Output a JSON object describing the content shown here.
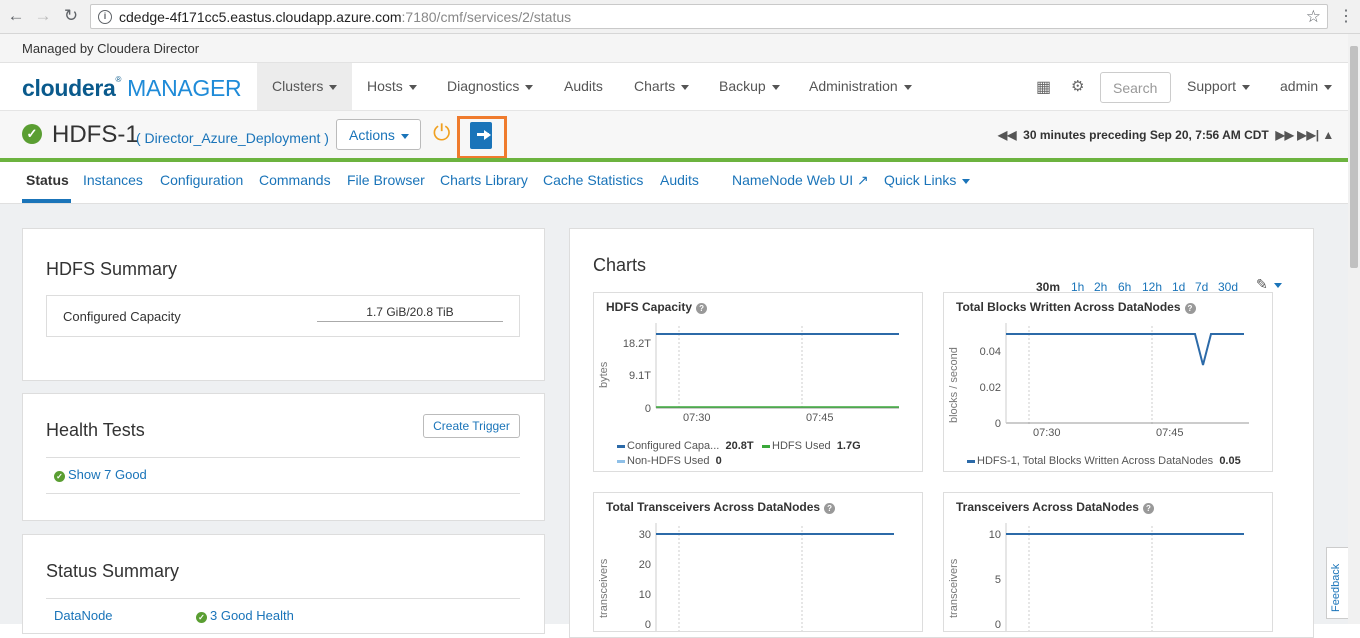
{
  "browser": {
    "url_host": "cdedge-4f171cc5.eastus.cloudapp.azure.com",
    "url_rest": ":7180/cmf/services/2/status"
  },
  "managed_by": "Managed by Cloudera Director",
  "topnav": {
    "logo_cloudera": "cloudera",
    "logo_manager": "MANAGER",
    "items": [
      "Clusters",
      "Hosts",
      "Diagnostics",
      "Audits",
      "Charts",
      "Backup",
      "Administration"
    ],
    "search_placeholder": "Search",
    "support": "Support",
    "user": "admin"
  },
  "service": {
    "name": "HDFS-1",
    "deployment": "( Director_Azure_Deployment )",
    "actions": "Actions",
    "timerange": "30 minutes preceding Sep 20, 7:56 AM CDT"
  },
  "subnav": [
    "Status",
    "Instances",
    "Configuration",
    "Commands",
    "File Browser",
    "Charts Library",
    "Cache Statistics",
    "Audits",
    "NameNode Web UI",
    "Quick Links"
  ],
  "hdfs_summary": {
    "title": "HDFS Summary",
    "capacity_label": "Configured Capacity",
    "capacity_value": "1.7 GiB/20.8 TiB"
  },
  "health_tests": {
    "title": "Health Tests",
    "create_trigger": "Create Trigger",
    "show_good": "Show 7 Good"
  },
  "status_summary": {
    "title": "Status Summary",
    "row_label": "DataNode",
    "row_value": "3 Good Health"
  },
  "charts_panel": {
    "title": "Charts",
    "ranges": [
      "30m",
      "1h",
      "2h",
      "6h",
      "12h",
      "1d",
      "7d",
      "30d"
    ],
    "active_range": "30m"
  },
  "colors": {
    "primary_blue": "#1a74b9",
    "accent_green": "#6cb33f",
    "highlight_orange": "#ef7b2d",
    "line_blue": "#2c6aa8",
    "hdfs_used_green": "#3aa83a",
    "non_hdfs_blue": "#8fc0e8"
  },
  "chart_data": [
    {
      "type": "line",
      "title": "HDFS Capacity",
      "ylabel": "bytes",
      "yticks": [
        "18.2T",
        "9.1T",
        "0"
      ],
      "xticks": [
        "07:30",
        "07:45"
      ],
      "series": [
        {
          "name": "Configured Capa...",
          "value_label": "20.8T"
        },
        {
          "name": "HDFS Used",
          "value_label": "1.7G"
        },
        {
          "name": "Non-HDFS Used",
          "value_label": "0"
        }
      ]
    },
    {
      "type": "line",
      "title": "Total Blocks Written Across DataNodes",
      "ylabel": "blocks / second",
      "yticks": [
        "0.04",
        "0.02",
        "0"
      ],
      "xticks": [
        "07:30",
        "07:45"
      ],
      "series": [
        {
          "name": "HDFS-1, Total Blocks Written Across DataNodes",
          "value_label": "0.05"
        }
      ]
    },
    {
      "type": "line",
      "title": "Total Transceivers Across DataNodes",
      "ylabel": "transceivers",
      "yticks": [
        "30",
        "20",
        "10",
        "0"
      ],
      "series": [
        {
          "values": [
            30,
            30
          ]
        }
      ]
    },
    {
      "type": "line",
      "title": "Transceivers Across DataNodes",
      "ylabel": "transceivers",
      "yticks": [
        "10",
        "5",
        "0"
      ],
      "series": [
        {
          "values": [
            10,
            10
          ]
        }
      ]
    }
  ],
  "feedback": "Feedback"
}
